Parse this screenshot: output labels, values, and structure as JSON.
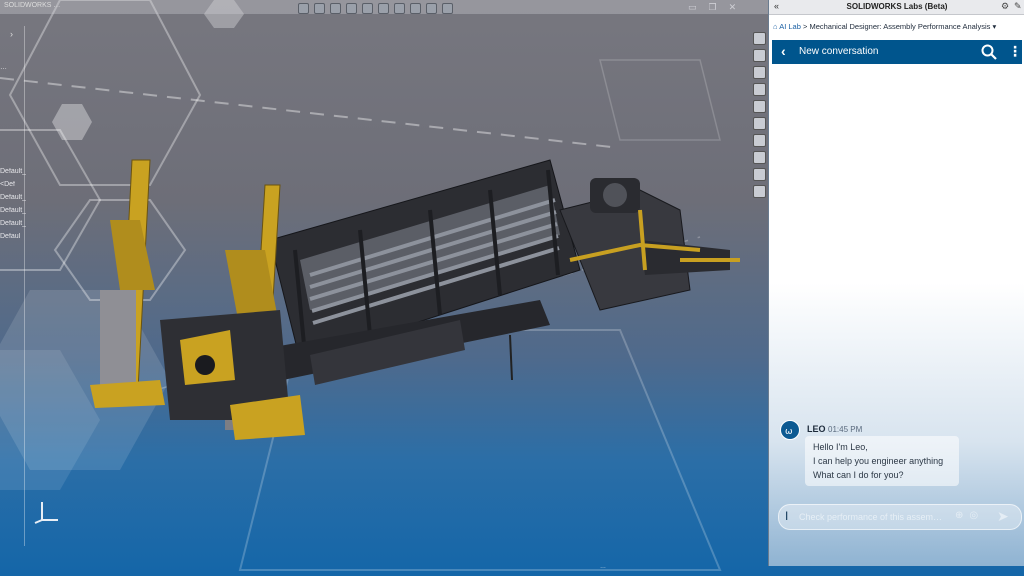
{
  "window": {
    "doc_title": "SOLIDWORKS …"
  },
  "tree": {
    "rows": [
      "…",
      "Default_",
      "<Def",
      "Default_",
      "Default_",
      "Default_",
      "Defaul"
    ]
  },
  "panel": {
    "title": "SOLIDWORKS Labs (Beta)",
    "collapse_icon": "double-chevron-left",
    "breadcrumb": {
      "home_label": "AI Lab",
      "separator": ">",
      "current": "Mechanical Designer: Assembly Performance Analysis",
      "dropdown": "▾"
    },
    "conversation": {
      "title": "New conversation",
      "back_icon": "chevron-left",
      "search_icon": "search",
      "more_icon": "kebab"
    },
    "message": {
      "sender": "LEO",
      "time": "01:45 PM",
      "lines": [
        "Hello I'm Leo,",
        "I can help you engineer anything",
        "What can I do for you?"
      ]
    },
    "input": {
      "placeholder": "Check performance of this assem…"
    },
    "accent": "#00558d"
  },
  "statusbar": {
    "text": "…"
  }
}
